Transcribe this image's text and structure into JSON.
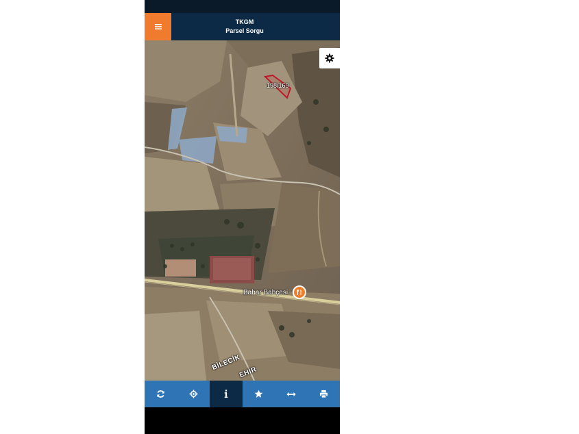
{
  "header": {
    "title": "TKGM",
    "subtitle": "Parsel Sorgu"
  },
  "map": {
    "parcel_label": "198/169",
    "poi_label": "Bahar Bahçesi",
    "road_label_1": "BİLECİK",
    "road_label_2": "EHİR"
  },
  "toolbar": {
    "items": [
      {
        "icon": "refresh-icon",
        "active": false
      },
      {
        "icon": "locate-icon",
        "active": false
      },
      {
        "icon": "info-icon",
        "active": true
      },
      {
        "icon": "star-icon",
        "active": false
      },
      {
        "icon": "measure-icon",
        "active": false
      },
      {
        "icon": "print-icon",
        "active": false
      }
    ]
  },
  "colors": {
    "header_bg": "#0c2a45",
    "menu_accent": "#f07b2e",
    "toolbar_bg": "#2f74b5",
    "toolbar_active": "#0c2a45",
    "parcel_outline": "#c0182a",
    "poi_marker": "#ef7d2a"
  }
}
